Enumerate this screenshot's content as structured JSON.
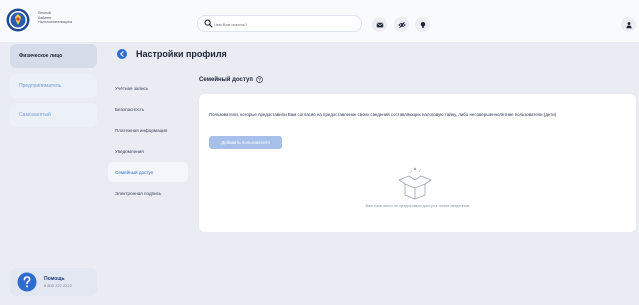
{
  "header": {
    "brand_lines": [
      "Личный",
      "Кабинет",
      "Налогоплательщика"
    ],
    "search": {
      "placeholder": "Чем Вам помочь?"
    },
    "icons": [
      "mail-icon",
      "eye-off-icon",
      "lightbulb-icon",
      "user-icon"
    ]
  },
  "left_nav": {
    "items": [
      {
        "label": "Физическое лицо",
        "state": "active"
      },
      {
        "label": "Предприниматель",
        "state": "inactive"
      },
      {
        "label": "Самозанятый",
        "state": "inactive"
      }
    ]
  },
  "help": {
    "title": "Помощь",
    "phone": "8 800 222 2222"
  },
  "page": {
    "title": "Настройки профиля"
  },
  "sub_nav": {
    "items": [
      {
        "label": "Учётная запись"
      },
      {
        "label": "Безопасность"
      },
      {
        "label": "Платежная информация"
      },
      {
        "label": "Уведомления"
      },
      {
        "label": "Семейный доступ",
        "active": true
      },
      {
        "label": "Электронная подпись"
      }
    ]
  },
  "section": {
    "title": "Семейный доступ",
    "description": "Пользователи, которые предоставили Вам согласие на предоставление своих сведений составляющих налоговую тайну, либо несовершеннолетние пользователи (дети)",
    "add_button": "Добавить пользователя",
    "empty_text": "Вам пока никто не предоставил доступ к своим сведениям"
  },
  "colors": {
    "accent": "#2f6ccf",
    "background": "#e9ecf3",
    "button_disabled": "#a6c0ea",
    "nav_active": "#d6ddea"
  }
}
